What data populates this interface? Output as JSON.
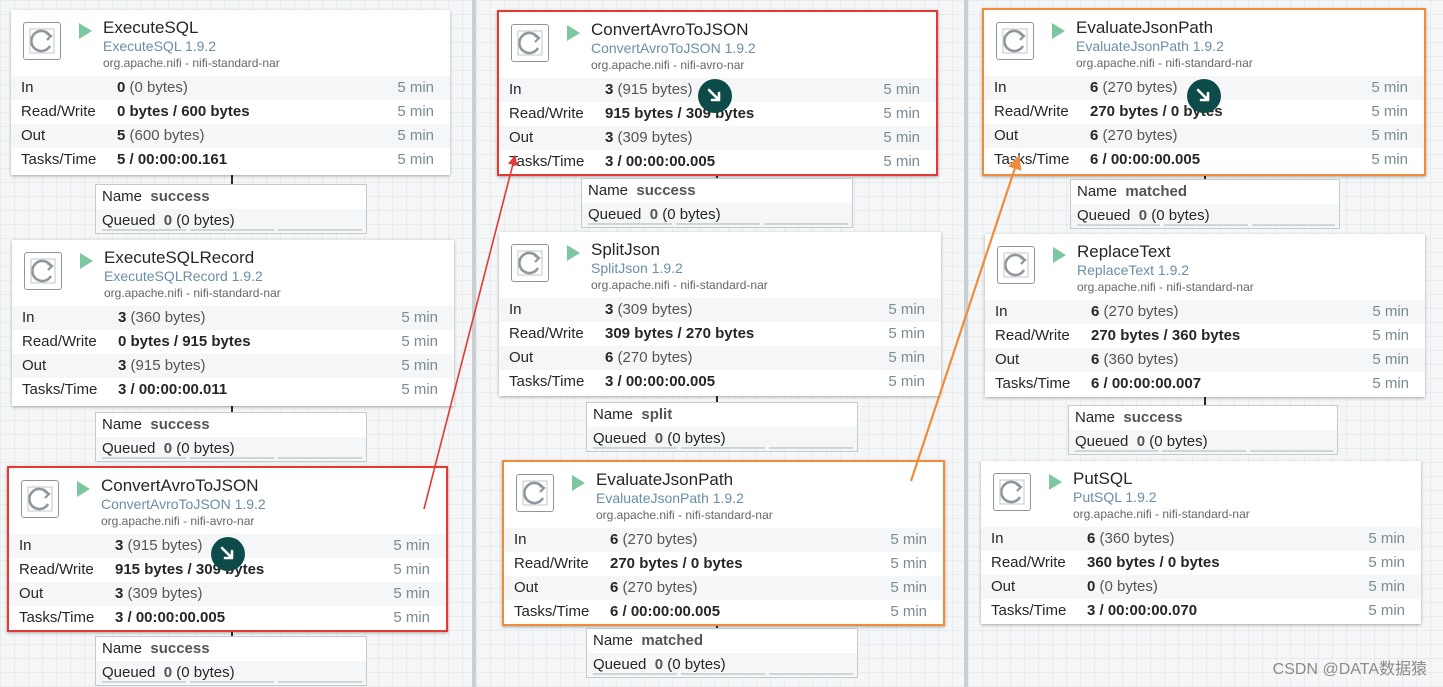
{
  "watermark": "CSDN @DATA数据猿",
  "columns": [
    {
      "processors": [
        {
          "name": "ExecuteSQL",
          "type": "ExecuteSQL 1.9.2",
          "bundle": "org.apache.nifi - nifi-standard-nar",
          "in_count": "0",
          "in_bytes": "(0 bytes)",
          "rw": "0 bytes / 600 bytes",
          "out_count": "5",
          "out_bytes": "(600 bytes)",
          "tasks": "5 / 00:00:00.161"
        },
        {
          "name": "ExecuteSQLRecord",
          "type": "ExecuteSQLRecord 1.9.2",
          "bundle": "org.apache.nifi - nifi-standard-nar",
          "in_count": "3",
          "in_bytes": "(360 bytes)",
          "rw": "0 bytes / 915 bytes",
          "out_count": "3",
          "out_bytes": "(915 bytes)",
          "tasks": "3 / 00:00:00.011"
        },
        {
          "name": "ConvertAvroToJSON",
          "type": "ConvertAvroToJSON 1.9.2",
          "bundle": "org.apache.nifi - nifi-avro-nar",
          "in_count": "3",
          "in_bytes": "(915 bytes)",
          "rw": "915 bytes / 309 bytes",
          "out_count": "3",
          "out_bytes": "(309 bytes)",
          "tasks": "3 / 00:00:00.005"
        }
      ],
      "connections": [
        {
          "relationship": "success",
          "queued_count": "0",
          "queued_bytes": "(0 bytes)"
        },
        {
          "relationship": "success",
          "queued_count": "0",
          "queued_bytes": "(0 bytes)"
        },
        {
          "relationship": "success",
          "queued_count": "0",
          "queued_bytes": "(0 bytes)"
        }
      ]
    },
    {
      "processors": [
        {
          "name": "ConvertAvroToJSON",
          "type": "ConvertAvroToJSON 1.9.2",
          "bundle": "org.apache.nifi - nifi-avro-nar",
          "in_count": "3",
          "in_bytes": "(915 bytes)",
          "rw": "915 bytes / 309 bytes",
          "out_count": "3",
          "out_bytes": "(309 bytes)",
          "tasks": "3 / 00:00:00.005"
        },
        {
          "name": "SplitJson",
          "type": "SplitJson 1.9.2",
          "bundle": "org.apache.nifi - nifi-standard-nar",
          "in_count": "3",
          "in_bytes": "(309 bytes)",
          "rw": "309 bytes / 270 bytes",
          "out_count": "6",
          "out_bytes": "(270 bytes)",
          "tasks": "3 / 00:00:00.005"
        },
        {
          "name": "EvaluateJsonPath",
          "type": "EvaluateJsonPath 1.9.2",
          "bundle": "org.apache.nifi - nifi-standard-nar",
          "in_count": "6",
          "in_bytes": "(270 bytes)",
          "rw": "270 bytes / 0 bytes",
          "out_count": "6",
          "out_bytes": "(270 bytes)",
          "tasks": "6 / 00:00:00.005"
        }
      ],
      "connections": [
        {
          "relationship": "success",
          "queued_count": "0",
          "queued_bytes": "(0 bytes)"
        },
        {
          "relationship": "split",
          "queued_count": "0",
          "queued_bytes": "(0 bytes)"
        },
        {
          "relationship": "matched",
          "queued_count": "0",
          "queued_bytes": "(0 bytes)"
        }
      ]
    },
    {
      "processors": [
        {
          "name": "EvaluateJsonPath",
          "type": "EvaluateJsonPath 1.9.2",
          "bundle": "org.apache.nifi - nifi-standard-nar",
          "in_count": "6",
          "in_bytes": "(270 bytes)",
          "rw": "270 bytes / 0 bytes",
          "out_count": "6",
          "out_bytes": "(270 bytes)",
          "tasks": "6 / 00:00:00.005"
        },
        {
          "name": "ReplaceText",
          "type": "ReplaceText 1.9.2",
          "bundle": "org.apache.nifi - nifi-standard-nar",
          "in_count": "6",
          "in_bytes": "(270 bytes)",
          "rw": "270 bytes / 360 bytes",
          "out_count": "6",
          "out_bytes": "(360 bytes)",
          "tasks": "6 / 00:00:00.007"
        },
        {
          "name": "PutSQL",
          "type": "PutSQL 1.9.2",
          "bundle": "org.apache.nifi - nifi-standard-nar",
          "in_count": "6",
          "in_bytes": "(360 bytes)",
          "rw": "360 bytes / 0 bytes",
          "out_count": "0",
          "out_bytes": "(0 bytes)",
          "tasks": "3 / 00:00:00.070"
        }
      ],
      "connections": [
        {
          "relationship": "matched",
          "queued_count": "0",
          "queued_bytes": "(0 bytes)"
        },
        {
          "relationship": "success",
          "queued_count": "0",
          "queued_bytes": "(0 bytes)"
        }
      ]
    }
  ],
  "labels": {
    "in": "In",
    "rw": "Read/Write",
    "out": "Out",
    "tasks": "Tasks/Time",
    "name": "Name",
    "queued": "Queued",
    "time": "5 min"
  },
  "colors": {
    "highlight_red": "#e53935",
    "highlight_orange": "#f08c3a",
    "run_icon": "#7dc7a0",
    "warning_badge": "#0d4a4a"
  },
  "icons": {
    "processor": "processor-icon",
    "run": "play-icon",
    "warning": "warning-icon"
  }
}
